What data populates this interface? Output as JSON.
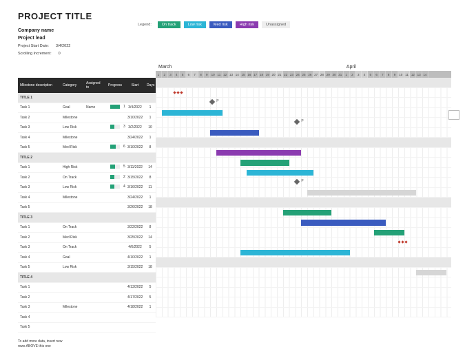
{
  "header": {
    "title": "PROJECT TITLE",
    "company_label": "Company name",
    "lead_label": "Project lead",
    "start_date_label": "Project Start Date:",
    "start_date_value": "3/4/2022",
    "scroll_label": "Scrolling Increment:",
    "scroll_value": "0"
  },
  "legend": {
    "label": "Legend:",
    "items": [
      {
        "label": "On track",
        "color": "#24a177"
      },
      {
        "label": "Low risk",
        "color": "#2cb5d6"
      },
      {
        "label": "Med risk",
        "color": "#3a5bbf"
      },
      {
        "label": "High risk",
        "color": "#8b3bb0"
      },
      {
        "label": "Unassigned",
        "color": "#eeeeee"
      }
    ]
  },
  "columns": {
    "desc": "Milestone description",
    "category": "Category",
    "assigned": "Assigned to",
    "progress": "Progress",
    "start": "Start",
    "days": "Days"
  },
  "timeline": {
    "months": [
      {
        "label": "March",
        "span": 31
      },
      {
        "label": "April",
        "span": 14
      }
    ],
    "start_day_index": 1,
    "days": [
      1,
      2,
      3,
      4,
      5,
      6,
      7,
      8,
      9,
      10,
      11,
      12,
      13,
      14,
      15,
      16,
      17,
      18,
      19,
      20,
      21,
      22,
      23,
      24,
      25,
      26,
      27,
      28,
      29,
      30,
      31,
      1,
      2,
      3,
      4,
      5,
      6,
      7,
      8,
      9,
      10,
      11,
      12,
      13,
      14
    ],
    "weekend_mod": [
      5,
      6
    ]
  },
  "chart_data": {
    "type": "gantt",
    "x_unit": "days",
    "x_start": "2022-03-01",
    "x_end": "2022-04-14",
    "categories": {
      "Goal": "#24a177",
      "Milestone": "diamond",
      "On Track": "#24a177",
      "Low Risk": "#2cb5d6",
      "Med Risk": "#3a5bbf",
      "High Risk": "#8b3bb0",
      "Unassigned": "#d6d6d6"
    },
    "groups": [
      {
        "title": "TITLE 1",
        "rows": [
          {
            "name": "Task 1",
            "category": "Goal",
            "assigned": "Name",
            "progress": 100,
            "start": "3/4/2022",
            "days": 1,
            "bar": {
              "offset": 3,
              "len": 0,
              "dots": 3
            }
          },
          {
            "name": "Task 2",
            "category": "Milestone",
            "assigned": "",
            "progress": null,
            "start": "3/10/2022",
            "days": 1,
            "bar": {
              "offset": 9,
              "len": 0,
              "milestone": true,
              "label": "P"
            }
          },
          {
            "name": "Task 3",
            "category": "Low Risk",
            "assigned": "",
            "progress": 35,
            "start": "3/2/2022",
            "days": 10,
            "bar": {
              "offset": 1,
              "len": 10,
              "color": "#2cb5d6"
            }
          },
          {
            "name": "Task 4",
            "category": "Milestone",
            "assigned": "",
            "progress": null,
            "start": "3/24/2022",
            "days": 1,
            "bar": {
              "offset": 23,
              "len": 0,
              "milestone": true,
              "label": "P"
            }
          },
          {
            "name": "Task 5",
            "category": "Med Risk",
            "assigned": "",
            "progress": 60,
            "start": "3/10/2022",
            "days": 8,
            "bar": {
              "offset": 9,
              "len": 8,
              "color": "#3a5bbf"
            }
          }
        ]
      },
      {
        "title": "TITLE 2",
        "rows": [
          {
            "name": "Task 1",
            "category": "High Risk",
            "assigned": "",
            "progress": 50,
            "start": "3/11/2022",
            "days": 14,
            "bar": {
              "offset": 10,
              "len": 14,
              "color": "#8b3bb0"
            }
          },
          {
            "name": "Task 2",
            "category": "On Track",
            "assigned": "",
            "progress": 25,
            "start": "3/15/2022",
            "days": 8,
            "bar": {
              "offset": 14,
              "len": 8,
              "color": "#24a177"
            }
          },
          {
            "name": "Task 3",
            "category": "Low Risk",
            "assigned": "",
            "progress": 40,
            "start": "3/16/2022",
            "days": 11,
            "bar": {
              "offset": 15,
              "len": 11,
              "color": "#2cb5d6"
            }
          },
          {
            "name": "Task 4",
            "category": "Milestone",
            "assigned": "",
            "progress": null,
            "start": "3/24/2022",
            "days": 1,
            "bar": {
              "offset": 23,
              "len": 0,
              "milestone": true,
              "label": "P"
            }
          },
          {
            "name": "Task 5",
            "category": "",
            "assigned": "",
            "progress": null,
            "start": "3/26/2022",
            "days": 18,
            "bar": {
              "offset": 25,
              "len": 18,
              "color": "#d6d6d6"
            }
          }
        ]
      },
      {
        "title": "TITLE 3",
        "rows": [
          {
            "name": "Task 1",
            "category": "On Track",
            "assigned": "",
            "progress": null,
            "start": "3/22/2022",
            "days": 8,
            "bar": {
              "offset": 21,
              "len": 8,
              "color": "#24a177"
            }
          },
          {
            "name": "Task 2",
            "category": "Med Risk",
            "assigned": "",
            "progress": null,
            "start": "3/25/2022",
            "days": 14,
            "bar": {
              "offset": 24,
              "len": 14,
              "color": "#3a5bbf"
            }
          },
          {
            "name": "Task 3",
            "category": "On Track",
            "assigned": "",
            "progress": null,
            "start": "4/6/2022",
            "days": 5,
            "bar": {
              "offset": 36,
              "len": 5,
              "color": "#24a177"
            }
          },
          {
            "name": "Task 4",
            "category": "Goal",
            "assigned": "",
            "progress": null,
            "start": "4/10/2022",
            "days": 1,
            "bar": {
              "offset": 40,
              "len": 0,
              "dots": 3
            }
          },
          {
            "name": "Task 5",
            "category": "Low Risk",
            "assigned": "",
            "progress": null,
            "start": "3/15/2022",
            "days": 18,
            "bar": {
              "offset": 14,
              "len": 18,
              "color": "#2cb5d6"
            }
          }
        ]
      },
      {
        "title": "TITLE 4",
        "rows": [
          {
            "name": "Task 1",
            "category": "",
            "assigned": "",
            "progress": null,
            "start": "4/13/2022",
            "days": 5,
            "bar": {
              "offset": 43,
              "len": 5,
              "color": "#d6d6d6"
            }
          },
          {
            "name": "Task 2",
            "category": "",
            "assigned": "",
            "progress": null,
            "start": "4/17/2022",
            "days": 5,
            "bar": null
          },
          {
            "name": "Task 3",
            "category": "Milestone",
            "assigned": "",
            "progress": null,
            "start": "4/18/2022",
            "days": 1,
            "bar": null
          },
          {
            "name": "Task 4",
            "category": "",
            "assigned": "",
            "progress": null,
            "start": "",
            "days": "",
            "bar": null
          },
          {
            "name": "Task 5",
            "category": "",
            "assigned": "",
            "progress": null,
            "start": "",
            "days": "",
            "bar": null
          }
        ]
      }
    ]
  },
  "footer": {
    "line1": "To add more data, insert new",
    "line2": "rows ABOVE this one"
  }
}
